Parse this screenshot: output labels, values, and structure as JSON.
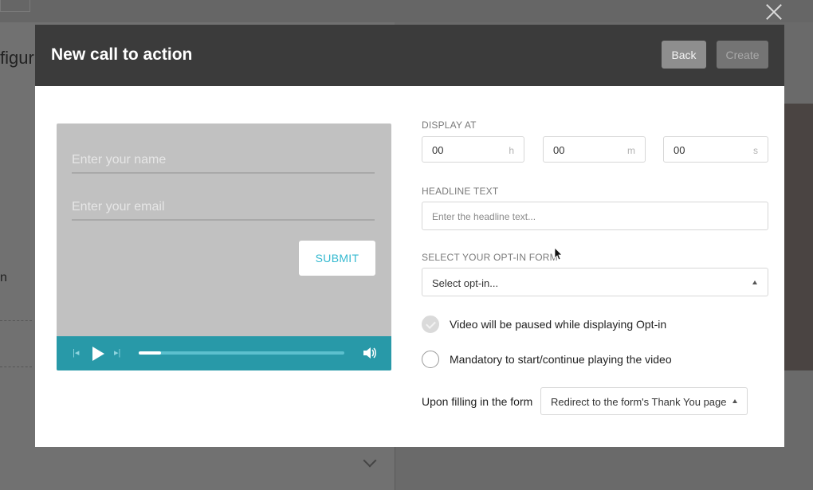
{
  "modal": {
    "title": "New call to action",
    "back_label": "Back",
    "create_label": "Create"
  },
  "background": {
    "title_fragment": "figur",
    "text_fragment": "n"
  },
  "preview": {
    "name_placeholder": "Enter your name",
    "email_placeholder": "Enter your email",
    "submit_label": "SUBMIT",
    "progress": 0.11,
    "icons": [
      "prev-icon",
      "play-icon",
      "next-icon",
      "volume-icon"
    ]
  },
  "form": {
    "display_at_label": "DISPLAY AT",
    "hours": {
      "value": "00",
      "unit": "h"
    },
    "minutes": {
      "value": "00",
      "unit": "m"
    },
    "seconds": {
      "value": "00",
      "unit": "s"
    },
    "headline_label": "HEADLINE TEXT",
    "headline_placeholder": "Enter the headline text...",
    "optin_label": "SELECT YOUR OPT-IN FORM",
    "optin_value": "Select opt-in...",
    "pause_option": "Video will be paused while displaying Opt-in",
    "pause_checked": true,
    "mandatory_option": "Mandatory to start/continue playing the video",
    "mandatory_checked": false,
    "after_fill_label": "Upon filling in the form",
    "after_fill_value": "Redirect to the form's Thank You page"
  },
  "colors": {
    "header_bg": "#3b3b3b",
    "player_bg": "#2899a8",
    "submit_text": "#34b9d0",
    "preview_bg": "#c1c1c1"
  }
}
